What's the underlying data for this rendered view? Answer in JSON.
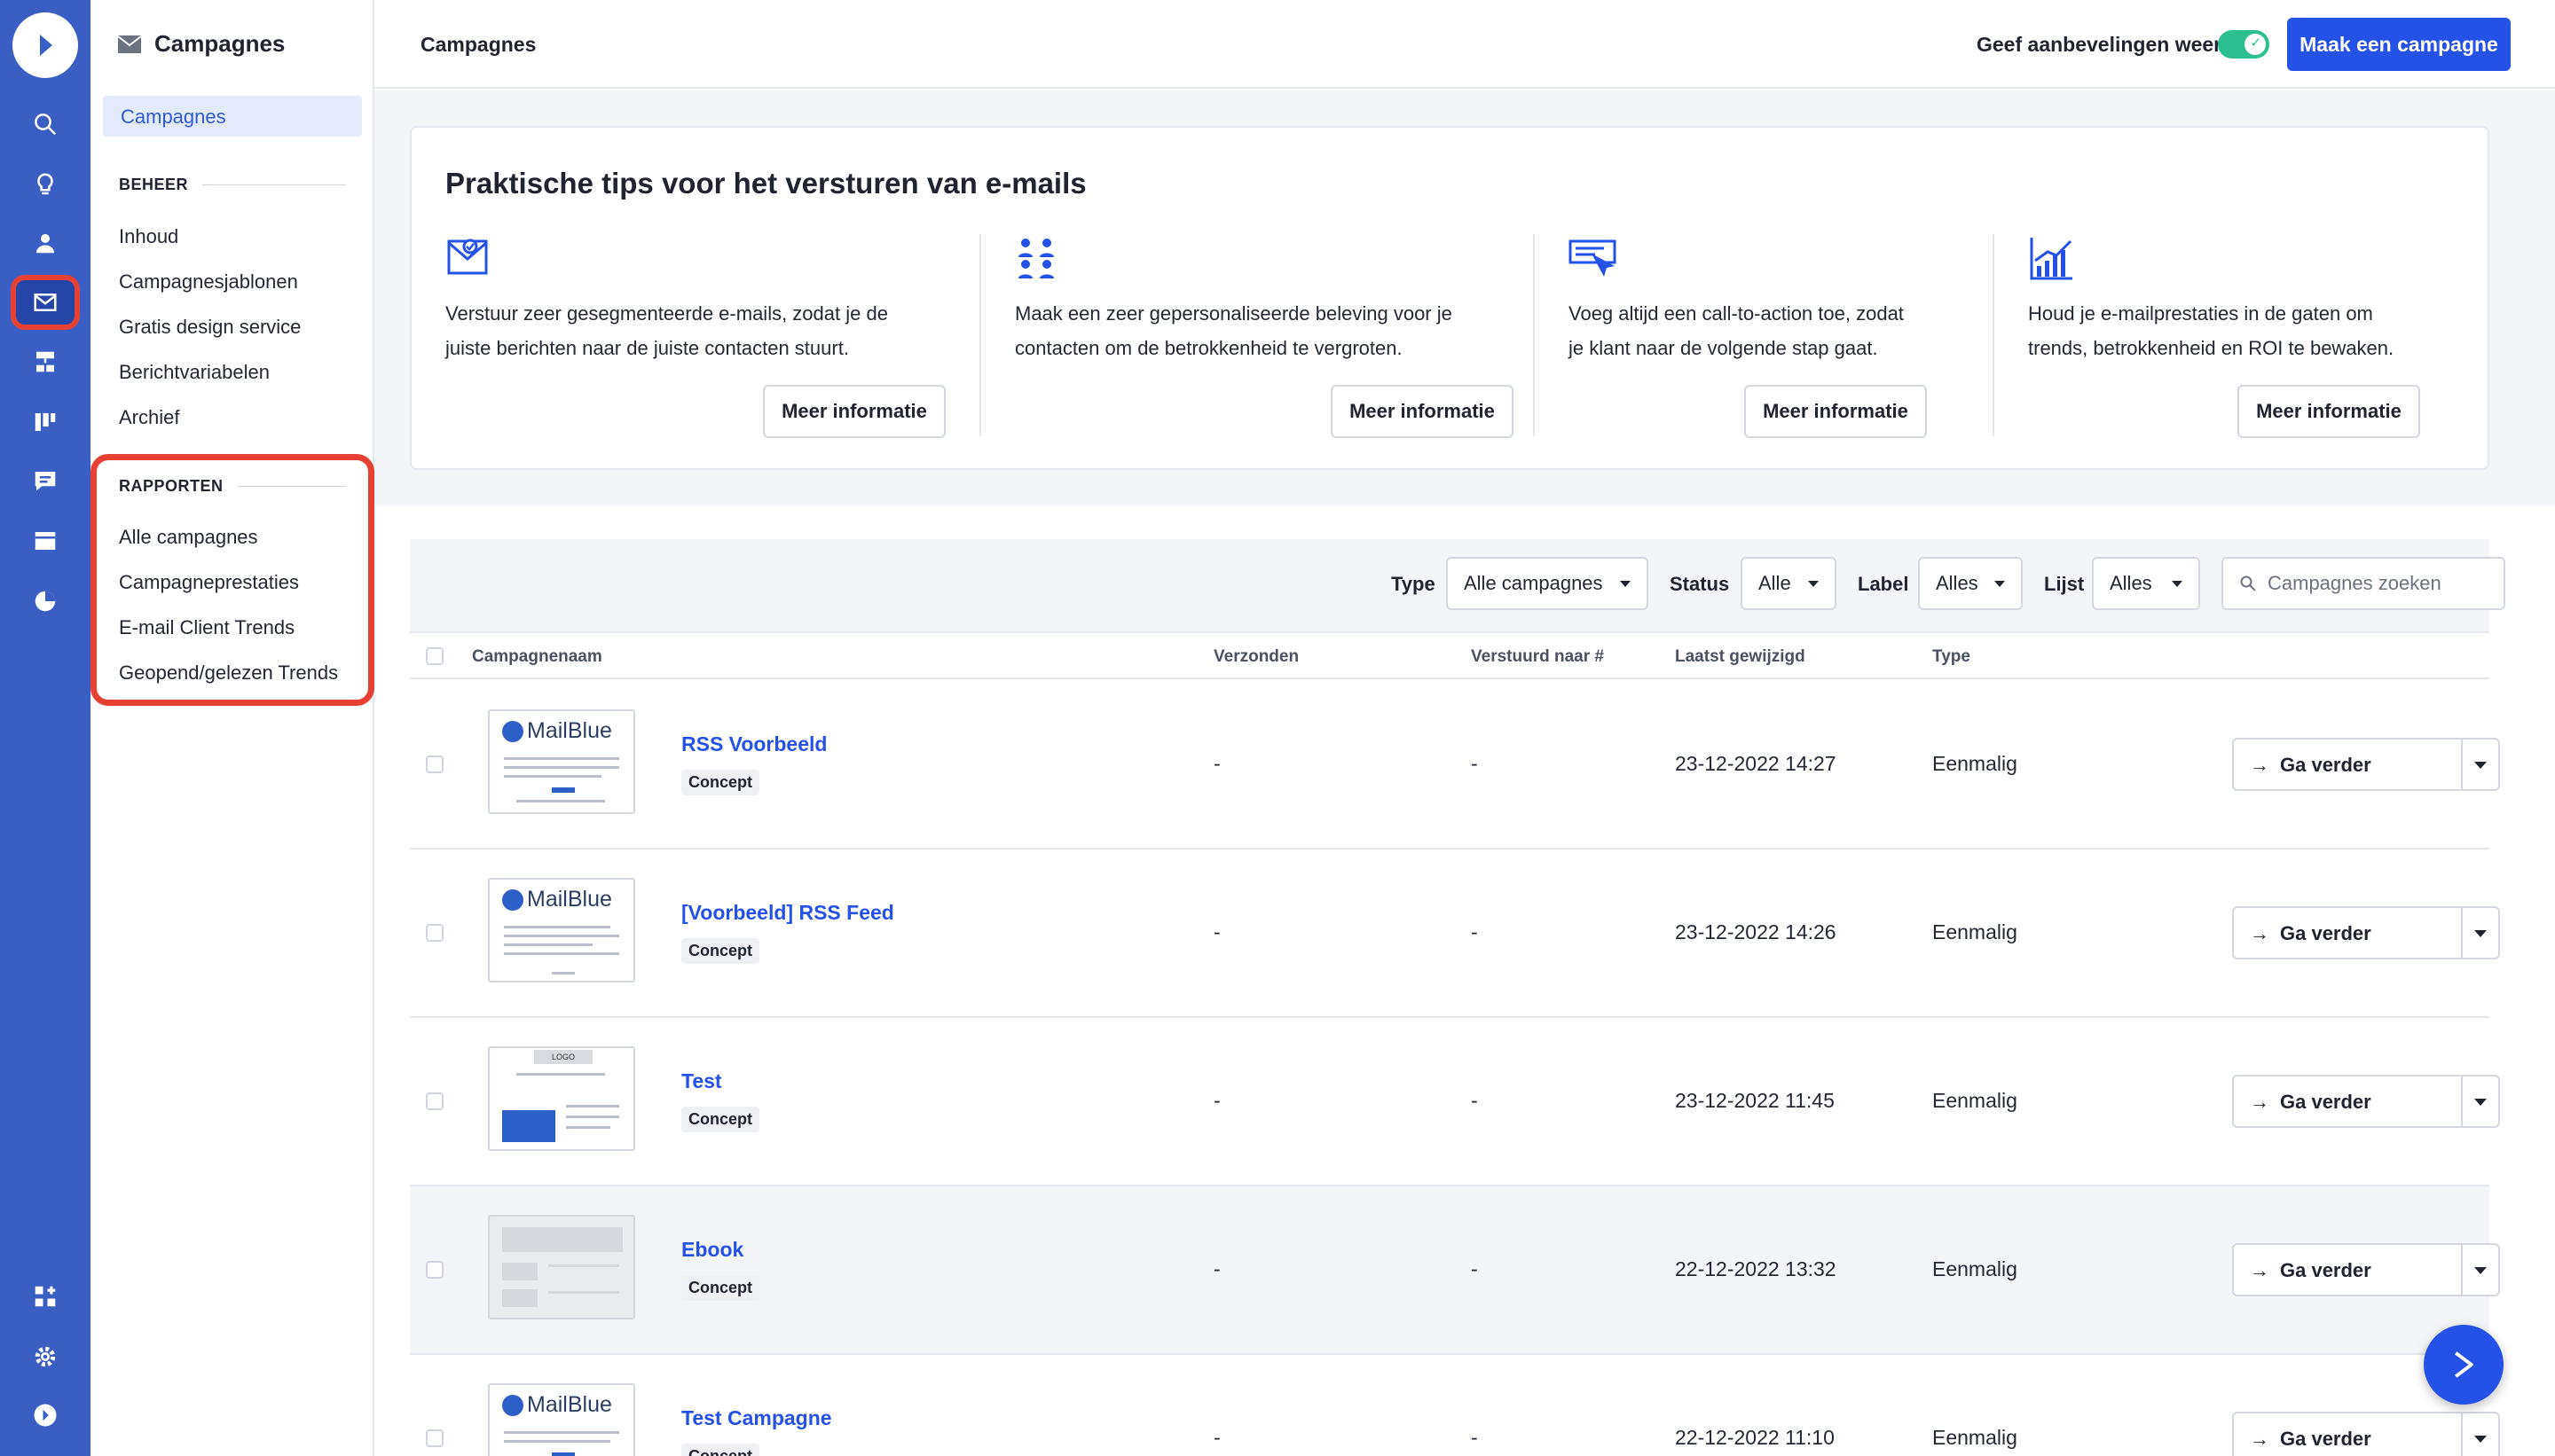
{
  "rail": {
    "icons": [
      "logo-icon",
      "search-icon",
      "lightbulb-icon",
      "contacts-icon",
      "mail-icon",
      "automation-icon",
      "deals-icon",
      "conversations-icon",
      "website-icon",
      "reports-icon",
      "apps-icon",
      "settings-icon",
      "brand-icon"
    ],
    "active": "mail-icon"
  },
  "sidebar": {
    "title": "Campagnes",
    "active_item": "Campagnes",
    "beheer": {
      "heading": "BEHEER",
      "items": [
        "Inhoud",
        "Campagnesjablonen",
        "Gratis design service",
        "Berichtvariabelen",
        "Archief"
      ]
    },
    "rapporten": {
      "heading": "RAPPORTEN",
      "items": [
        "Alle campagnes",
        "Campagneprestaties",
        "E-mail Client Trends",
        "Geopend/gelezen Trends"
      ]
    }
  },
  "topbar": {
    "breadcrumb": "Campagnes",
    "recommendations_label": "Geef aanbevelingen weer",
    "recommendations_on": true,
    "create_button": "Maak een campagne"
  },
  "tips": {
    "title": "Praktische tips voor het versturen van e-mails",
    "items": [
      {
        "icon": "segmented-mail-icon",
        "line1": "Verstuur zeer gesegmenteerde e-mails, zodat je de",
        "line2": "juiste berichten naar de juiste contacten stuurt.",
        "button": "Meer informatie"
      },
      {
        "icon": "people-icon",
        "line1": "Maak een zeer gepersonaliseerde beleving voor je",
        "line2": "contacten om de betrokkenheid te vergroten.",
        "button": "Meer informatie"
      },
      {
        "icon": "call-to-action-icon",
        "line1": "Voeg altijd een call-to-action toe, zodat",
        "line2": "je klant naar de volgende stap gaat.",
        "button": "Meer informatie"
      },
      {
        "icon": "trend-chart-icon",
        "line1": "Houd je e-mailprestaties in de gaten om",
        "line2": "trends, betrokkenheid en ROI te bewaken.",
        "button": "Meer informatie"
      }
    ]
  },
  "filters": {
    "type_label": "Type",
    "type_value": "Alle campagnes",
    "status_label": "Status",
    "status_value": "Alle",
    "label_label": "Label",
    "label_value": "Alles",
    "list_label": "Lijst",
    "list_value": "Alles",
    "search_placeholder": "Campagnes zoeken"
  },
  "table": {
    "columns": [
      "Campagnenaam",
      "Verzonden",
      "Verstuurd naar #",
      "Laatst gewijzigd",
      "Type"
    ],
    "rows": [
      {
        "name": "RSS Voorbeeld",
        "status": "Concept",
        "sent": "-",
        "sent_to": "-",
        "modified": "23-12-2022 14:27",
        "type": "Eenmalig",
        "action": "Ga verder",
        "thumb": "MailBlue"
      },
      {
        "name": "[Voorbeeld] RSS Feed",
        "status": "Concept",
        "sent": "-",
        "sent_to": "-",
        "modified": "23-12-2022 14:26",
        "type": "Eenmalig",
        "action": "Ga verder",
        "thumb": "MailBlue"
      },
      {
        "name": "Test",
        "status": "Concept",
        "sent": "-",
        "sent_to": "-",
        "modified": "23-12-2022 11:45",
        "type": "Eenmalig",
        "action": "Ga verder",
        "thumb": "LOGO"
      },
      {
        "name": "Ebook",
        "status": "Concept",
        "sent": "-",
        "sent_to": "-",
        "modified": "22-12-2022 13:32",
        "type": "Eenmalig",
        "action": "Ga verder",
        "thumb": ""
      },
      {
        "name": "Test Campagne",
        "status": "Concept",
        "sent": "-",
        "sent_to": "-",
        "modified": "22-12-2022 11:10",
        "type": "Eenmalig",
        "action": "Ga verder",
        "thumb": "MailBlue"
      }
    ]
  },
  "colors": {
    "rail": "#3a5fc4",
    "primary": "#2451e6",
    "highlight": "#e64032",
    "toggle_on": "#2bbf8f"
  }
}
